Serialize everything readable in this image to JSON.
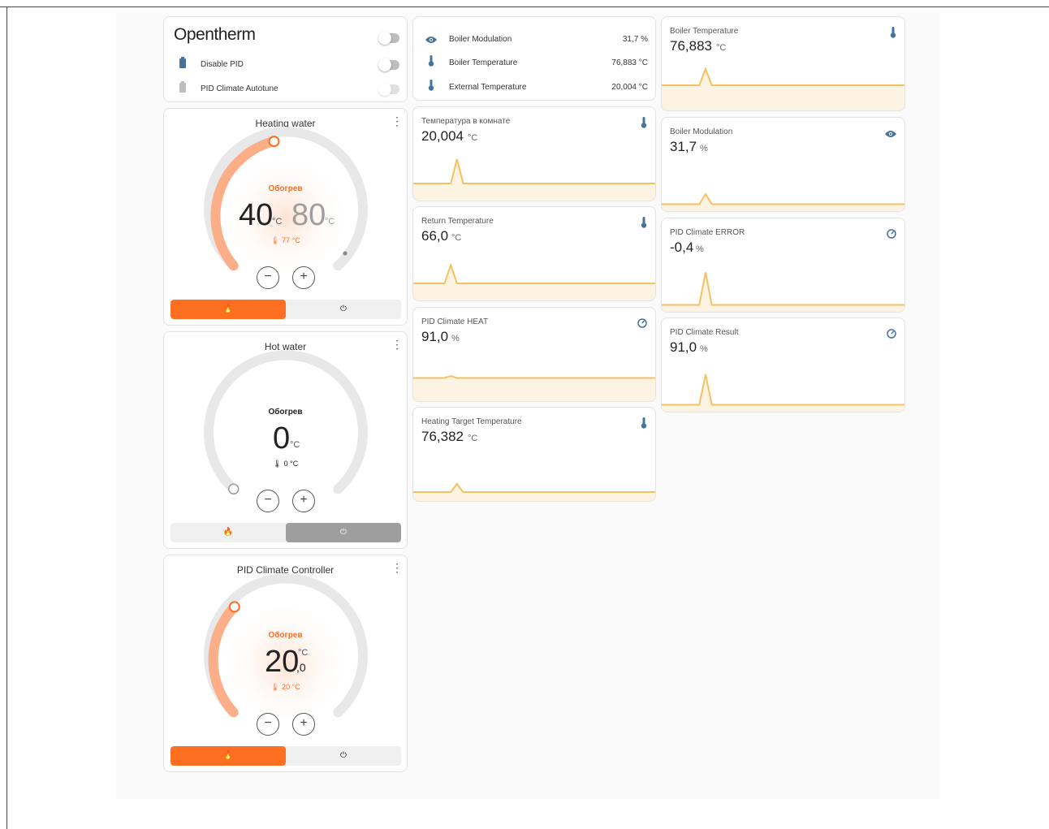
{
  "entities_card": {
    "title": "Opentherm",
    "rows": [
      {
        "label": "Disable PID",
        "icon": "battery-icon"
      },
      {
        "label": "PID Climate Autotune",
        "icon": "battery-icon"
      }
    ]
  },
  "sensors_card": {
    "rows": [
      {
        "label": "Boiler Modulation",
        "value": "31,7 %",
        "icon": "eye-icon"
      },
      {
        "label": "Boiler Temperature",
        "value": "76,883 °C",
        "icon": "thermometer-icon"
      },
      {
        "label": "External Temperature",
        "value": "20,004 °C",
        "icon": "thermometer-icon"
      }
    ]
  },
  "thermostats": [
    {
      "title": "Heating water",
      "mode": "Обогрев",
      "target_low": "40",
      "target_high": "80",
      "unit": "°C",
      "current": "🌡 77 °C",
      "level": 0.43,
      "heat_label": "🔥",
      "off_label": "⏻",
      "active": "heat",
      "accent": "#ff6f22"
    },
    {
      "title": "Hot water",
      "mode": "Обогрев",
      "target": "0",
      "unit": "°C",
      "current": "🌡 0 °C",
      "level": 0.0,
      "heat_label": "🔥",
      "off_label": "⏻",
      "active": "off",
      "accent": "#222222"
    },
    {
      "title": "PID Climate Controller",
      "mode": "Обогрев",
      "target": "20",
      "decimal": ",0",
      "unit": "°C",
      "current": "🌡 20 °C",
      "level": 0.2,
      "heat_label": "🔥",
      "off_label": "⏻",
      "active": "heat",
      "accent": "#ff6f22"
    }
  ],
  "sensor_graphs": [
    {
      "name": "Температура в комнате",
      "value": "20,004",
      "unit": "°C",
      "icon": "thermometer-icon",
      "trend": [
        0.3,
        0.3,
        0.3,
        0.3,
        0.3,
        0.3,
        0.3,
        0.9,
        0.3,
        0.3,
        0.3,
        0.3,
        0.3,
        0.3,
        0.3,
        0.3,
        0.3,
        0.3,
        0.3,
        0.3,
        0.3,
        0.3,
        0.3,
        0.3,
        0.3,
        0.3,
        0.3,
        0.3,
        0.3,
        0.3,
        0.3,
        0.3,
        0.3,
        0.3,
        0.3,
        0.3,
        0.3,
        0.3,
        0.3,
        0.3
      ]
    },
    {
      "name": "Return Temperature",
      "value": "66,0",
      "unit": "°C",
      "icon": "thermometer-icon",
      "trend": [
        0.3,
        0.3,
        0.3,
        0.3,
        0.3,
        0.3,
        0.75,
        0.3,
        0.3,
        0.3,
        0.3,
        0.3,
        0.3,
        0.3,
        0.3,
        0.3,
        0.3,
        0.3,
        0.3,
        0.3,
        0.3,
        0.3,
        0.3,
        0.3,
        0.3,
        0.3,
        0.3,
        0.3,
        0.3,
        0.3,
        0.3,
        0.3,
        0.3,
        0.3,
        0.3,
        0.3,
        0.3,
        0.3,
        0.3,
        0.3
      ]
    },
    {
      "name": "PID Climate HEAT",
      "value": "91,0",
      "unit": "%",
      "icon": "gauge-icon",
      "trend": [
        0.45,
        0.45,
        0.45,
        0.45,
        0.45,
        0.45,
        0.5,
        0.45,
        0.45,
        0.45,
        0.45,
        0.45,
        0.45,
        0.45,
        0.45,
        0.45,
        0.45,
        0.45,
        0.45,
        0.45,
        0.45,
        0.45,
        0.45,
        0.45,
        0.45,
        0.45,
        0.45,
        0.45,
        0.45,
        0.45,
        0.45,
        0.45,
        0.45,
        0.45,
        0.45,
        0.45,
        0.45,
        0.45,
        0.45,
        0.45
      ]
    },
    {
      "name": "Heating Target Temperature",
      "value": "76,382",
      "unit": "°C",
      "icon": "thermometer-icon",
      "trend": [
        0.1,
        0.1,
        0.1,
        0.1,
        0.1,
        0.1,
        0.1,
        0.3,
        0.1,
        0.1,
        0.1,
        0.1,
        0.1,
        0.1,
        0.1,
        0.1,
        0.1,
        0.1,
        0.1,
        0.1,
        0.1,
        0.1,
        0.1,
        0.1,
        0.1,
        0.1,
        0.1,
        0.1,
        0.1,
        0.1,
        0.1,
        0.1,
        0.1,
        0.1,
        0.1,
        0.1,
        0.1,
        0.1,
        0.1,
        0.1
      ]
    },
    {
      "name": "Boiler Temperature",
      "value": "76,883",
      "unit": "°C",
      "icon": "thermometer-icon",
      "trend": [
        0.5,
        0.5,
        0.5,
        0.5,
        0.5,
        0.5,
        0.5,
        0.9,
        0.5,
        0.5,
        0.5,
        0.5,
        0.5,
        0.5,
        0.5,
        0.5,
        0.5,
        0.5,
        0.5,
        0.5,
        0.5,
        0.5,
        0.5,
        0.5,
        0.5,
        0.5,
        0.5,
        0.5,
        0.5,
        0.5,
        0.5,
        0.5,
        0.5,
        0.5,
        0.5,
        0.5,
        0.5,
        0.5,
        0.5,
        0.5
      ]
    },
    {
      "name": "Boiler Modulation",
      "value": "31,7",
      "unit": "%",
      "icon": "eye-icon",
      "trend": [
        0.05,
        0.05,
        0.05,
        0.05,
        0.05,
        0.05,
        0.05,
        0.3,
        0.05,
        0.05,
        0.05,
        0.05,
        0.05,
        0.05,
        0.05,
        0.05,
        0.05,
        0.05,
        0.05,
        0.05,
        0.05,
        0.05,
        0.05,
        0.05,
        0.05,
        0.05,
        0.05,
        0.05,
        0.05,
        0.05,
        0.05,
        0.05,
        0.05,
        0.05,
        0.05,
        0.05,
        0.05,
        0.05,
        0.05,
        0.05
      ]
    },
    {
      "name": "PID Climate ERROR",
      "value": "-0,4",
      "unit": "%",
      "icon": "gauge-icon",
      "trend": [
        0.05,
        0.05,
        0.05,
        0.05,
        0.05,
        0.05,
        0.05,
        0.85,
        0.05,
        0.05,
        0.05,
        0.05,
        0.05,
        0.05,
        0.05,
        0.05,
        0.05,
        0.05,
        0.05,
        0.05,
        0.05,
        0.05,
        0.05,
        0.05,
        0.05,
        0.05,
        0.05,
        0.05,
        0.05,
        0.05,
        0.05,
        0.05,
        0.05,
        0.05,
        0.05,
        0.05,
        0.05,
        0.05,
        0.05,
        0.05
      ]
    },
    {
      "name": "PID Climate Result",
      "value": "91,0",
      "unit": "%",
      "icon": "gauge-icon",
      "trend": [
        0.05,
        0.05,
        0.05,
        0.05,
        0.05,
        0.05,
        0.05,
        0.8,
        0.05,
        0.05,
        0.05,
        0.05,
        0.05,
        0.05,
        0.05,
        0.05,
        0.05,
        0.05,
        0.05,
        0.05,
        0.05,
        0.05,
        0.05,
        0.05,
        0.05,
        0.05,
        0.05,
        0.05,
        0.05,
        0.05,
        0.05,
        0.05,
        0.05,
        0.05,
        0.05,
        0.05,
        0.05,
        0.05,
        0.05,
        0.05
      ]
    }
  ],
  "colors": {
    "accent": "#ff6f22",
    "graph_line": "#f6c261",
    "graph_fill": "#fdf3e3",
    "icon_blue": "#44739e"
  }
}
